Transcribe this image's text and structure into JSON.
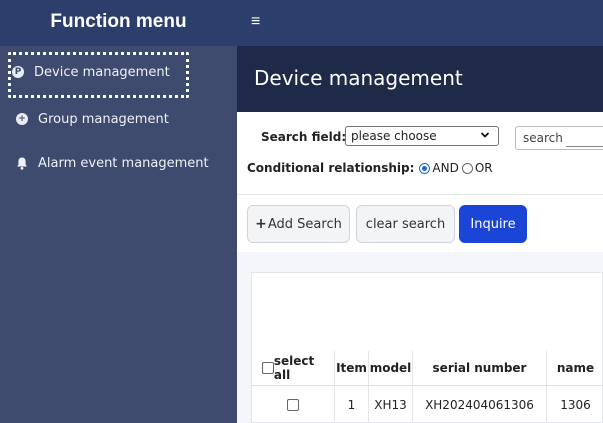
{
  "sidebar": {
    "title": "Function menu",
    "items": [
      {
        "label": "Device management",
        "icon": "p-circle-icon",
        "icon_glyph": "P"
      },
      {
        "label": "Group management",
        "icon": "plus-circle-icon",
        "icon_glyph": "+"
      },
      {
        "label": "Alarm event management",
        "icon": "bell-icon",
        "icon_glyph": "🔔"
      }
    ]
  },
  "topbar": {
    "menu_icon": "≡"
  },
  "page": {
    "title": "Device management"
  },
  "search": {
    "field_label": "Search field:",
    "field_value": "please choose",
    "input_placeholder": "search",
    "conditional_label": "Conditional relationship:",
    "option_and": "AND",
    "option_or": "OR",
    "selected": "AND"
  },
  "buttons": {
    "add": "Add Search",
    "clear": "clear search",
    "inquire": "Inquire"
  },
  "table": {
    "columns": [
      "select all",
      "Item",
      "model",
      "serial number",
      "name"
    ],
    "rows": [
      {
        "item": "1",
        "model": "XH13",
        "serial": "XH202404061306",
        "name": "1306"
      }
    ]
  },
  "colors": {
    "sidebar": "#3f4b6e",
    "topbar": "#2c3e6b",
    "header": "#1e2a47",
    "accent": "#1a45d6"
  }
}
